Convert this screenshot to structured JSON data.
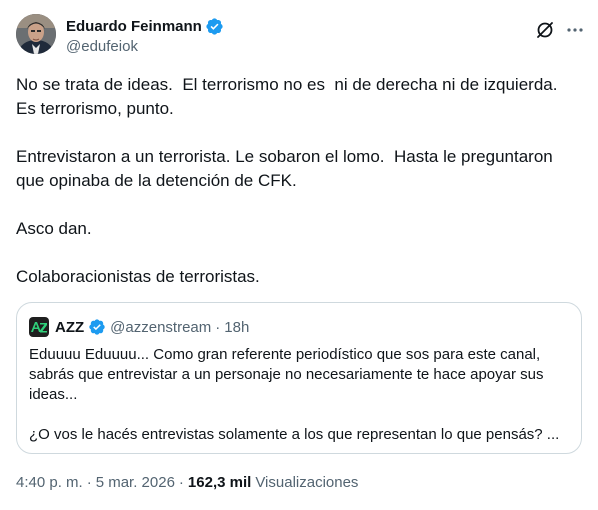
{
  "author": {
    "display_name": "Eduardo Feinmann",
    "handle": "@edufeiok",
    "verified": true
  },
  "tweet": {
    "paragraphs": [
      "No se trata de ideas.  El terrorismo no es  ni de derecha ni de izquierda. Es terrorismo, punto.",
      "Entrevistaron a un terrorista. Le sobaron el lomo.  Hasta le preguntaron que opinaba de la detención de CFK.",
      "Asco dan.",
      "Colaboracionistas de terroristas."
    ]
  },
  "quote": {
    "display_name": "AZZ",
    "handle": "@azzenstream",
    "separator": "·",
    "time": "18h",
    "paragraphs": [
      "Eduuuu Eduuuu... Como gran referente periodístico que sos para este canal, sabrás que entrevistar a un personaje no necesariamente te hace apoyar sus ideas...",
      "¿O vos le hacés entrevistas solamente a los que representan lo que pensás? ..."
    ]
  },
  "meta": {
    "time": "4:40 p. m.",
    "separator": "·",
    "date": "5 mar. 2026",
    "views_count": "162,3 mil",
    "views_label": "Visualizaciones"
  },
  "icons": {
    "verified": "verified-badge-icon",
    "grok": "grok-icon",
    "more": "more-options-icon"
  },
  "colors": {
    "text_primary": "#0f1419",
    "text_secondary": "#536471",
    "verified_blue": "#1d9bf0",
    "border": "#cfd9de",
    "azz_green": "#2fd07a"
  }
}
